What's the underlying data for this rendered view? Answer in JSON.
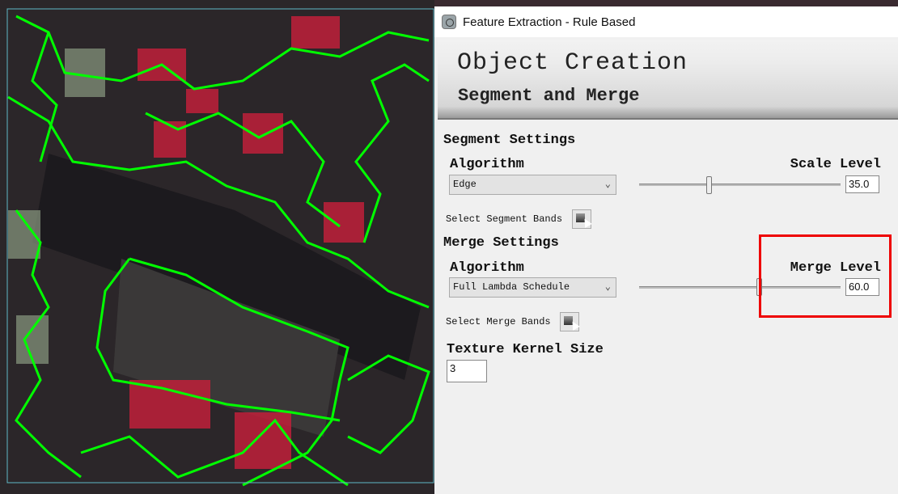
{
  "window": {
    "title": "Feature Extraction - Rule Based",
    "icon": "app-icon"
  },
  "banner": {
    "title": "Object Creation",
    "subtitle": "Segment and Merge"
  },
  "segment": {
    "heading": "Segment Settings",
    "algorithm_label": "Algorithm",
    "algorithm": "Edge",
    "scale_label": "Scale Level",
    "scale_value": "35.0",
    "scale_fraction": 0.35,
    "bands_label": "Select Segment Bands"
  },
  "merge": {
    "heading": "Merge Settings",
    "algorithm_label": "Algorithm",
    "algorithm": "Full Lambda Schedule",
    "level_label": "Merge Level",
    "level_value": "60.0",
    "level_fraction": 0.6,
    "bands_label": "Select Merge Bands"
  },
  "texture": {
    "label": "Texture Kernel Size",
    "value": "3"
  },
  "colors": {
    "segment_outline": "#00ff00",
    "highlight": "#e00000"
  }
}
